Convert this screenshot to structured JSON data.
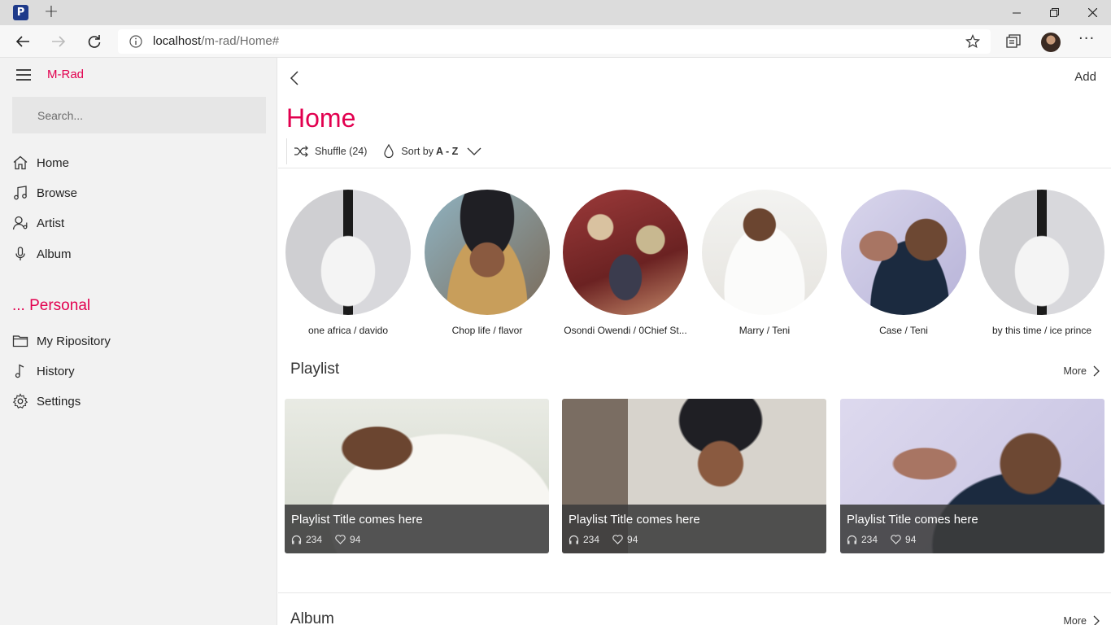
{
  "browser": {
    "favicon_letter": "P",
    "new_tab_symbol": "+",
    "url_host": "localhost",
    "url_path": "/m-rad/Home#",
    "more_symbol": "···"
  },
  "sidebar": {
    "brand": "M-Rad",
    "search_placeholder": "Search...",
    "items": [
      {
        "label": "Home",
        "icon": "home-icon"
      },
      {
        "label": "Browse",
        "icon": "music-note-icon"
      },
      {
        "label": "Artist",
        "icon": "artist-icon"
      },
      {
        "label": "Album",
        "icon": "microphone-icon"
      }
    ],
    "personal_heading": "... Personal",
    "personal_items": [
      {
        "label": "My Ripository",
        "icon": "folder-icon"
      },
      {
        "label": "History",
        "icon": "note-icon"
      },
      {
        "label": "Settings",
        "icon": "gear-icon"
      }
    ]
  },
  "main": {
    "add_label": "Add",
    "title": "Home",
    "shuffle_label": "Shuffle (24)",
    "sort_prefix": "Sort by",
    "sort_value": "A - Z",
    "artists": [
      {
        "name": "one africa / davido"
      },
      {
        "name": "Chop life / flavor"
      },
      {
        "name": "Osondi Owendi / 0Chief St..."
      },
      {
        "name": "Marry / Teni"
      },
      {
        "name": "Case / Teni"
      },
      {
        "name": "by this time / ice prince"
      }
    ],
    "playlist_heading": "Playlist",
    "playlist_more": "More",
    "playlists": [
      {
        "title": "Playlist Title comes here",
        "plays": "234",
        "likes": "94"
      },
      {
        "title": "Playlist Title comes here",
        "plays": "234",
        "likes": "94"
      },
      {
        "title": "Playlist Title comes here",
        "plays": "234",
        "likes": "94"
      }
    ],
    "album_heading": "Album",
    "album_more": "More"
  },
  "colors": {
    "accent": "#e2004f",
    "sidebar_bg": "#f2f2f2"
  }
}
